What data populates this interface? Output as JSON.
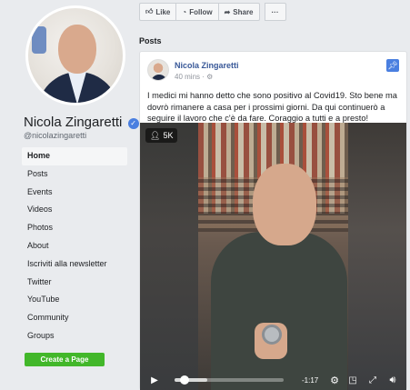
{
  "profile": {
    "name": "Nicola Zingaretti",
    "verified_mark": "✓",
    "handle": "@nicolazingaretti"
  },
  "nav": {
    "items": [
      {
        "label": "Home",
        "active": true
      },
      {
        "label": "Posts"
      },
      {
        "label": "Events"
      },
      {
        "label": "Videos"
      },
      {
        "label": "Photos"
      },
      {
        "label": "About"
      },
      {
        "label": "Iscriviti alla newsletter"
      },
      {
        "label": "Twitter"
      },
      {
        "label": "YouTube"
      },
      {
        "label": "Community"
      },
      {
        "label": "Groups"
      }
    ],
    "create_page_label": "Create a Page"
  },
  "actions": {
    "like_label": "Like",
    "follow_label": "Follow",
    "share_label": "Share",
    "more_label": "···",
    "icons": {
      "like": "thumbs-up-icon",
      "follow": "rss-icon",
      "share": "share-arrow-icon",
      "more": "more-dots-icon"
    }
  },
  "section_title": "Posts",
  "post": {
    "author": "Nicola Zingaretti",
    "time": "40 mins",
    "separator": "·",
    "pinned_icon": "pin-icon",
    "text": "I medici mi hanno detto che sono positivo al Covid19. Sto bene ma dovrò rimanere a casa per i prossimi giorni. Da qui continuerò a seguire il lavoro che c'è da fare. Coraggio a tutti e a presto!",
    "video": {
      "views": "5K",
      "time_remaining": "-1:17",
      "progress_fraction": 0.05,
      "buffered_fraction": 0.3
    }
  },
  "colors": {
    "page_bg": "#e9ebee",
    "link_blue": "#385898",
    "verified_blue": "#4a7fe0",
    "create_page_green": "#42b72a"
  }
}
